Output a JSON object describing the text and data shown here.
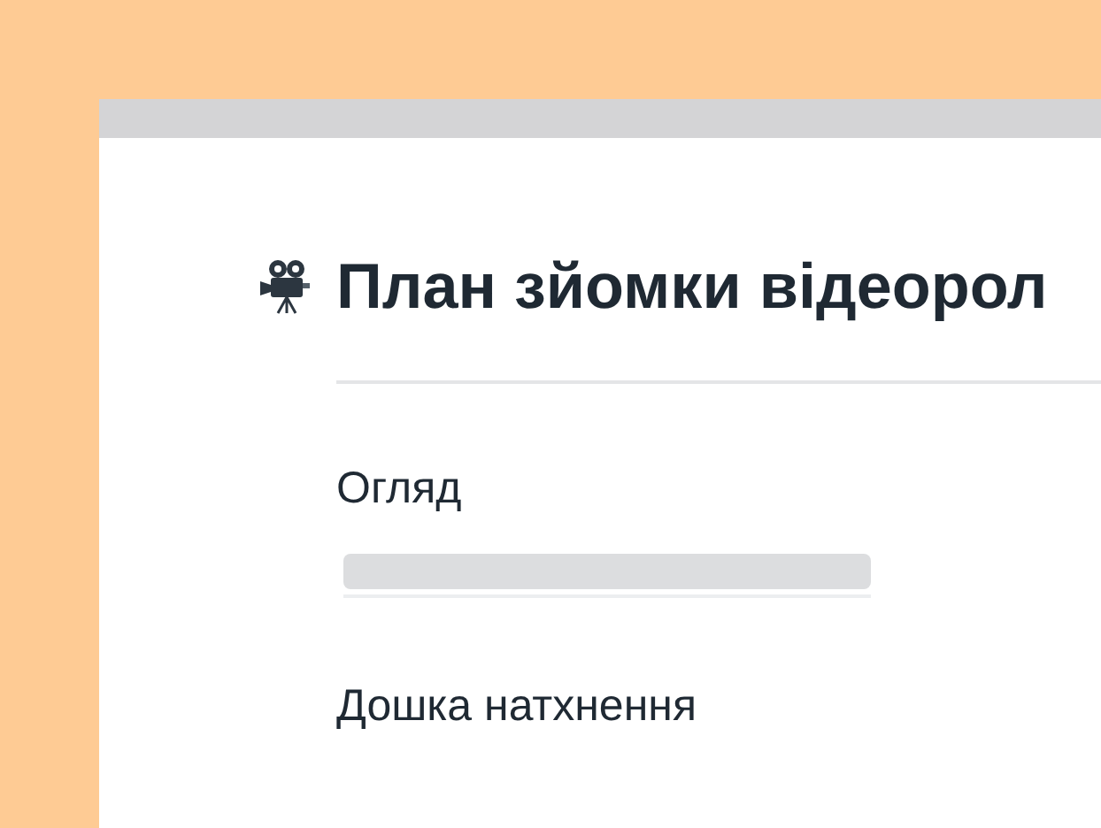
{
  "page": {
    "title": "План зйомки відеорол"
  },
  "sections": [
    {
      "heading": "Огляд",
      "kind": "skeleton"
    },
    {
      "heading": "Дошка натхнення"
    }
  ]
}
